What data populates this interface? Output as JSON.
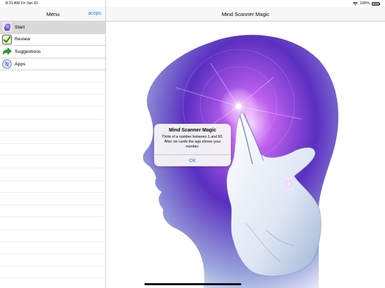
{
  "status_bar": {
    "time": "8:31 AM",
    "date": "Fri Jan 31",
    "battery": "100%"
  },
  "sidebar": {
    "title": "Menu",
    "action_label": "acops",
    "items": [
      {
        "label": "Start",
        "icon": "head-icon",
        "selected": true
      },
      {
        "label": "Review",
        "icon": "checkmark-icon",
        "selected": false
      },
      {
        "label": "Suggestions",
        "icon": "arrow-icon",
        "selected": false
      },
      {
        "label": "Apps",
        "icon": "apps-icon",
        "selected": false
      }
    ]
  },
  "main": {
    "title": "Mind Scanner Magic"
  },
  "alert": {
    "title": "Mind Scanner Magic",
    "message": "Think of a number between 1 and 60. After six cards the app shows your number.",
    "ok_label": "OK"
  },
  "colors": {
    "accent": "#1a7cf6",
    "selected_row": "#d9d9d9",
    "head_purple": "#5a2fc0"
  }
}
